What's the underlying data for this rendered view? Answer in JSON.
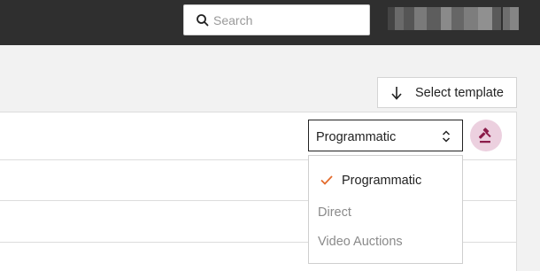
{
  "search": {
    "placeholder": "Search"
  },
  "toolbar": {
    "select_template_label": "Select template"
  },
  "deal_type_select": {
    "value": "Programmatic",
    "options": [
      {
        "label": "Programmatic",
        "selected": true
      },
      {
        "label": "Direct",
        "selected": false
      },
      {
        "label": "Video Auctions",
        "selected": false
      }
    ]
  },
  "icons": {
    "search": "search-icon",
    "arrow_down": "arrow-down-icon",
    "chevron": "chevron-up-down-icon",
    "auction": "gavel-icon",
    "check": "check-icon",
    "user": "blurred-user-avatar"
  },
  "colors": {
    "topbar": "#2f2f2f",
    "accent": "#e36b2c",
    "gavel_bg": "#ecd0df",
    "gavel_fg": "#8b1c4a"
  }
}
